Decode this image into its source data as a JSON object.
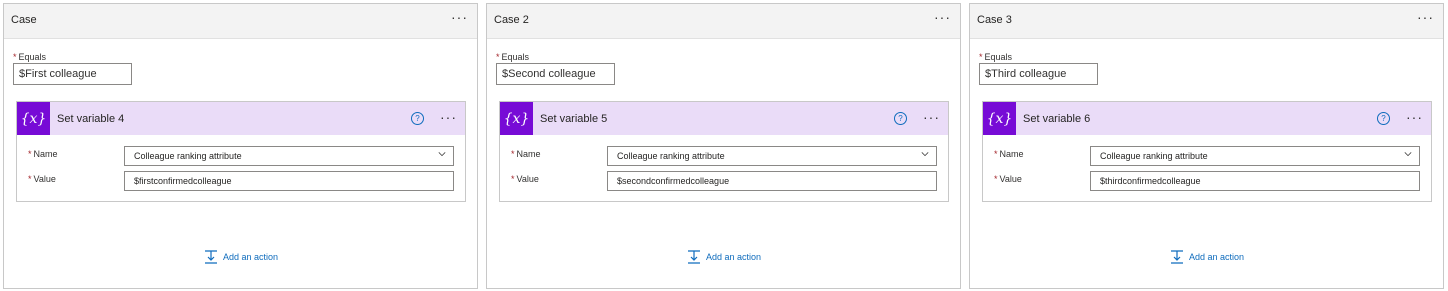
{
  "cases": [
    {
      "title": "Case",
      "equals_label": "Equals",
      "equals_value": "$First colleague",
      "action": {
        "icon_text": "{x}",
        "title": "Set variable 4",
        "name_label": "Name",
        "name_value": "Colleague ranking attribute",
        "value_label": "Value",
        "value_value": "$firstconfirmedcolleague"
      },
      "add_action_label": "Add an action"
    },
    {
      "title": "Case 2",
      "equals_label": "Equals",
      "equals_value": "$Second colleague",
      "action": {
        "icon_text": "{x}",
        "title": "Set variable 5",
        "name_label": "Name",
        "name_value": "Colleague ranking attribute",
        "value_label": "Value",
        "value_value": "$secondconfirmedcolleague"
      },
      "add_action_label": "Add an action"
    },
    {
      "title": "Case 3",
      "equals_label": "Equals",
      "equals_value": "$Third colleague",
      "action": {
        "icon_text": "{x}",
        "title": "Set variable 6",
        "name_label": "Name",
        "name_value": "Colleague ranking attribute",
        "value_label": "Value",
        "value_value": "$thirdconfirmedcolleague"
      },
      "add_action_label": "Add an action"
    }
  ],
  "common": {
    "more_glyph": "···",
    "help_glyph": "?",
    "required_mark": "*"
  },
  "colors": {
    "accent": "#770bd6",
    "header_tint": "#eadcf8",
    "link": "#0f6cbd",
    "required": "#a4262c"
  }
}
